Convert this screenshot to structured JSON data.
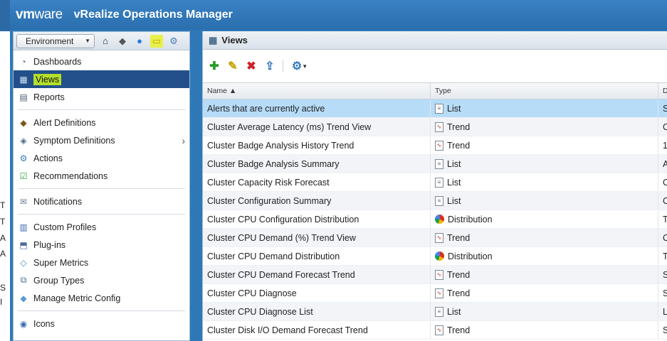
{
  "app": {
    "logo_vm": "vm",
    "logo_ware": "ware",
    "product": "vRealize Operations Manager"
  },
  "behind_chars": [
    "T",
    "T",
    "A",
    "A",
    "S",
    "I"
  ],
  "sidebar": {
    "environment_label": "Environment",
    "items": [
      {
        "label": "Dashboards",
        "icon": "dashboard-icon"
      },
      {
        "label": "Views",
        "icon": "views-icon",
        "active": true
      },
      {
        "label": "Reports",
        "icon": "reports-icon"
      },
      {
        "label": "Alert Definitions",
        "icon": "alert-definitions-icon"
      },
      {
        "label": "Symptom Definitions",
        "icon": "symptom-definitions-icon"
      },
      {
        "label": "Actions",
        "icon": "actions-icon"
      },
      {
        "label": "Recommendations",
        "icon": "recommendations-icon"
      },
      {
        "label": "Notifications",
        "icon": "notifications-icon"
      },
      {
        "label": "Custom Profiles",
        "icon": "custom-profiles-icon"
      },
      {
        "label": "Plug-ins",
        "icon": "plugins-icon"
      },
      {
        "label": "Super Metrics",
        "icon": "super-metrics-icon"
      },
      {
        "label": "Group Types",
        "icon": "group-types-icon"
      },
      {
        "label": "Manage Metric Config",
        "icon": "metric-config-icon"
      },
      {
        "label": "Icons",
        "icon": "icons-icon"
      }
    ]
  },
  "main": {
    "title": "Views",
    "columns": {
      "name": "Name ▲",
      "type": "Type",
      "desc": "D"
    },
    "rows": [
      {
        "name": "Alerts that are currently active",
        "type": "List",
        "desc": "S"
      },
      {
        "name": "Cluster Average Latency (ms) Trend View",
        "type": "Trend",
        "desc": "C"
      },
      {
        "name": "Cluster Badge Analysis History Trend",
        "type": "Trend",
        "desc": "1"
      },
      {
        "name": "Cluster Badge Analysis Summary",
        "type": "List",
        "desc": "A"
      },
      {
        "name": "Cluster Capacity Risk Forecast",
        "type": "List",
        "desc": "C"
      },
      {
        "name": "Cluster Configuration Summary",
        "type": "List",
        "desc": "C"
      },
      {
        "name": "Cluster CPU Configuration Distribution",
        "type": "Distribution",
        "desc": "T"
      },
      {
        "name": "Cluster CPU Demand (%) Trend View",
        "type": "Trend",
        "desc": "C"
      },
      {
        "name": "Cluster CPU Demand Distribution",
        "type": "Distribution",
        "desc": "T"
      },
      {
        "name": "Cluster CPU Demand Forecast Trend",
        "type": "Trend",
        "desc": "S"
      },
      {
        "name": "Cluster CPU Diagnose",
        "type": "Trend",
        "desc": "S"
      },
      {
        "name": "Cluster CPU Diagnose List",
        "type": "List",
        "desc": "L"
      },
      {
        "name": "Cluster Disk I/O Demand Forecast Trend",
        "type": "Trend",
        "desc": "S"
      }
    ]
  }
}
